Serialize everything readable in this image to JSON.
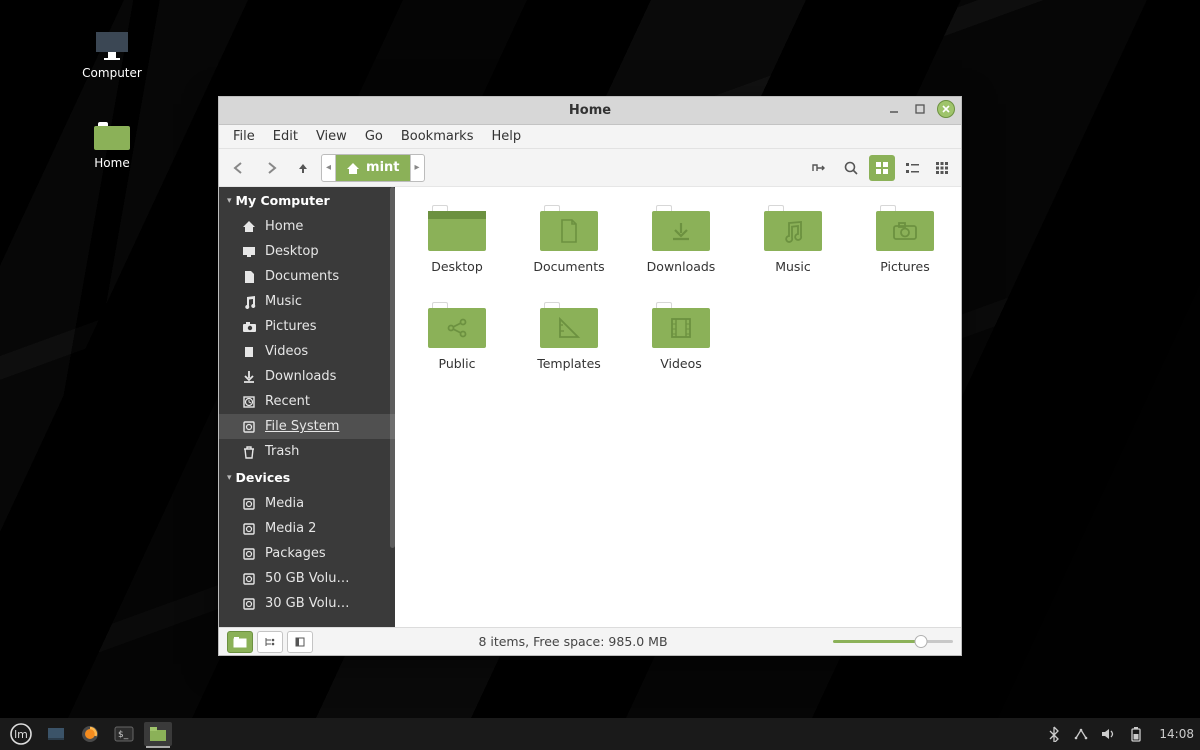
{
  "desktop_icons": [
    {
      "id": "computer",
      "label": "Computer"
    },
    {
      "id": "home",
      "label": "Home"
    }
  ],
  "window": {
    "title": "Home",
    "controls": {
      "minimize": "–",
      "maximize": "▫",
      "close": "×"
    },
    "menu": [
      "File",
      "Edit",
      "View",
      "Go",
      "Bookmarks",
      "Help"
    ],
    "toolbar": {
      "back": "back",
      "forward": "forward",
      "up": "up"
    },
    "path": {
      "current": "mint"
    },
    "view_buttons": [
      "toggle-location",
      "search",
      "icon-view",
      "list-view",
      "compact-view"
    ],
    "active_view": "icon-view"
  },
  "sidebar": {
    "sections": [
      {
        "title": "My Computer",
        "items": [
          {
            "icon": "home",
            "label": "Home",
            "selected": false
          },
          {
            "icon": "desktop",
            "label": "Desktop"
          },
          {
            "icon": "document",
            "label": "Documents"
          },
          {
            "icon": "music",
            "label": "Music"
          },
          {
            "icon": "camera",
            "label": "Pictures"
          },
          {
            "icon": "video",
            "label": "Videos"
          },
          {
            "icon": "download",
            "label": "Downloads"
          },
          {
            "icon": "recent",
            "label": "Recent"
          },
          {
            "icon": "disk",
            "label": "File System",
            "underline": true,
            "selected": true
          },
          {
            "icon": "trash",
            "label": "Trash"
          }
        ]
      },
      {
        "title": "Devices",
        "items": [
          {
            "icon": "disk",
            "label": "Media"
          },
          {
            "icon": "disk",
            "label": "Media 2"
          },
          {
            "icon": "disk",
            "label": "Packages"
          },
          {
            "icon": "disk",
            "label": "50 GB Volu…"
          },
          {
            "icon": "disk",
            "label": "30 GB Volu…"
          }
        ]
      }
    ]
  },
  "folders": [
    {
      "name": "Desktop",
      "glyph": "desktop"
    },
    {
      "name": "Documents",
      "glyph": "doc"
    },
    {
      "name": "Downloads",
      "glyph": "down"
    },
    {
      "name": "Music",
      "glyph": "music"
    },
    {
      "name": "Pictures",
      "glyph": "camera"
    },
    {
      "name": "Public",
      "glyph": "share"
    },
    {
      "name": "Templates",
      "glyph": "ruler"
    },
    {
      "name": "Videos",
      "glyph": "film"
    }
  ],
  "statusbar": {
    "buttons": [
      "places",
      "tree",
      "close-side"
    ],
    "active": "places",
    "text": "8 items, Free space: 985.0 MB"
  },
  "panel": {
    "tasks": [
      "show-desktop",
      "firefox",
      "terminal",
      "files"
    ],
    "active_task": "files",
    "clock": "14:08"
  }
}
